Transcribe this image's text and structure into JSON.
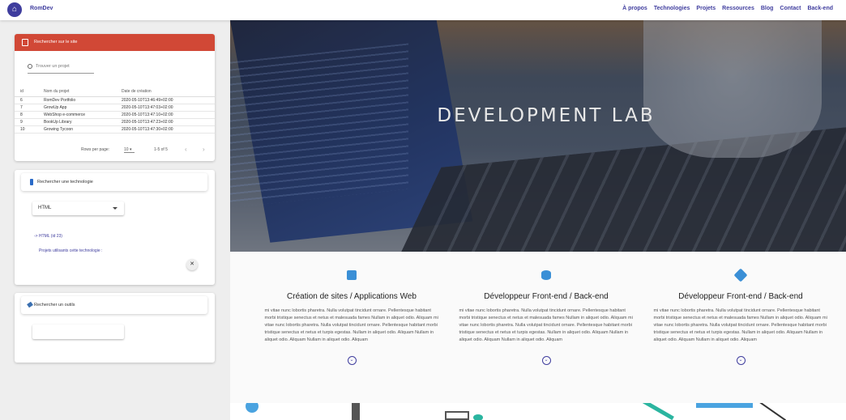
{
  "brand": {
    "name": "RomDev",
    "logo_icon": "home-icon"
  },
  "nav": [
    "À propos",
    "Technologies",
    "Projets",
    "Ressources",
    "Blog",
    "Contact",
    "Back-end"
  ],
  "search_card": {
    "title": "Rechercher sur le site",
    "search_placeholder": "Trouver un projet",
    "columns": [
      "id",
      "Nom du projet",
      "Date de création"
    ],
    "rows": [
      [
        "6",
        "RomDev Portfolio",
        "2020-05-10T13:46:49+02:00"
      ],
      [
        "7",
        "GrowUp App",
        "2020-05-10T13:47:03+02:00"
      ],
      [
        "8",
        "WebShop e-commerce",
        "2020-05-10T13:47:10+02:00"
      ],
      [
        "9",
        "BookUp Library",
        "2020-05-10T13:47:23+02:00"
      ],
      [
        "10",
        "Growing Tycoon",
        "2020-05-10T13:47:30+02:00"
      ]
    ],
    "rows_per_page_label": "Rows per page:",
    "rows_per_page": "10",
    "range": "1-5 of 5"
  },
  "tech_card": {
    "title": "Rechercher une technologie",
    "selected": "HTML",
    "result": "-> HTML (id 23)",
    "projects_link": "Projets utilisants cette technologie :",
    "close": "✕"
  },
  "tools_card": {
    "title": "Rechercher un outils",
    "input_value": ""
  },
  "hero": {
    "title": "DEVELOPMENT LAB"
  },
  "features": [
    {
      "icon": "cube-icon",
      "title": "Création de sites / Applications Web",
      "text": "mi vitae nunc lobortis pharetra. Nulla volutpat tincidunt ornare. Pellentesque habitant morbi tristique senectus et netus et malesuada fames Nullam in aliquet odio. Aliquam mi vitae nunc lobortis pharetra. Nulla volutpat tincidunt ornare. Pellentesque habitant morbi tristique senectus et netus et turpis egestas. Nullam in aliquet odio. Aliquam Nullam in aliquet odio. Aliquam Nullam in aliquet odio. Aliquam"
    },
    {
      "icon": "database-icon",
      "title": "Développeur Front-end / Back-end",
      "text": "mi vitae nunc lobortis pharetra. Nulla volutpat tincidunt ornare. Pellentesque habitant morbi tristique senectus et netus et malesuada fames Nullam in aliquet odio. Aliquam mi vitae nunc lobortis pharetra. Nulla volutpat tincidunt ornare. Pellentesque habitant morbi tristique senectus et netus et turpis egestas. Nullam in aliquet odio. Aliquam Nullam in aliquet odio. Aliquam Nullam in aliquet odio. Aliquam"
    },
    {
      "icon": "box-icon",
      "title": "Développeur Front-end / Back-end",
      "text": "mi vitae nunc lobortis pharetra. Nulla volutpat tincidunt ornare. Pellentesque habitant morbi tristique senectus et netus et malesuada fames Nullam in aliquet odio. Aliquam mi vitae nunc lobortis pharetra. Nulla volutpat tincidunt ornare. Pellentesque habitant morbi tristique senectus et netus et turpis egestas. Nullam in aliquet odio. Aliquam Nullam in aliquet odio. Aliquam Nullam in aliquet odio. Aliquam"
    }
  ],
  "colors": {
    "brand": "#3f3d9e",
    "header_red": "#d14836",
    "icon_blue": "#3a8fd6"
  }
}
